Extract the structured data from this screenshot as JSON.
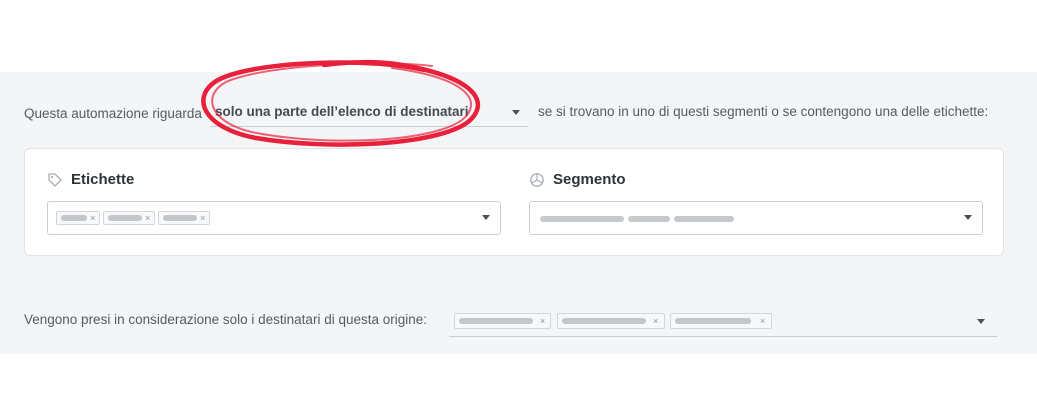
{
  "automation": {
    "intro_text": "Questa automazione riguarda",
    "scope_value": "solo una parte dell’elenco di destinatari",
    "after_text": "se si trovano in uno di questi segmenti o se contengono una delle etichette:"
  },
  "tags": {
    "title": "Etichette",
    "icon": "tag-icon",
    "chips": [
      {
        "remove": "×"
      },
      {
        "remove": "×"
      },
      {
        "remove": "×"
      }
    ]
  },
  "segment": {
    "title": "Segmento",
    "icon": "segment-icon"
  },
  "origin": {
    "label": "Vengono presi in considerazione solo i destinatari di questa origine:",
    "chips": [
      {
        "remove": "×"
      },
      {
        "remove": "×"
      },
      {
        "remove": "×"
      }
    ]
  },
  "colors": {
    "panel_bg": "#f4f5f7",
    "annotation": "#e8203a"
  }
}
